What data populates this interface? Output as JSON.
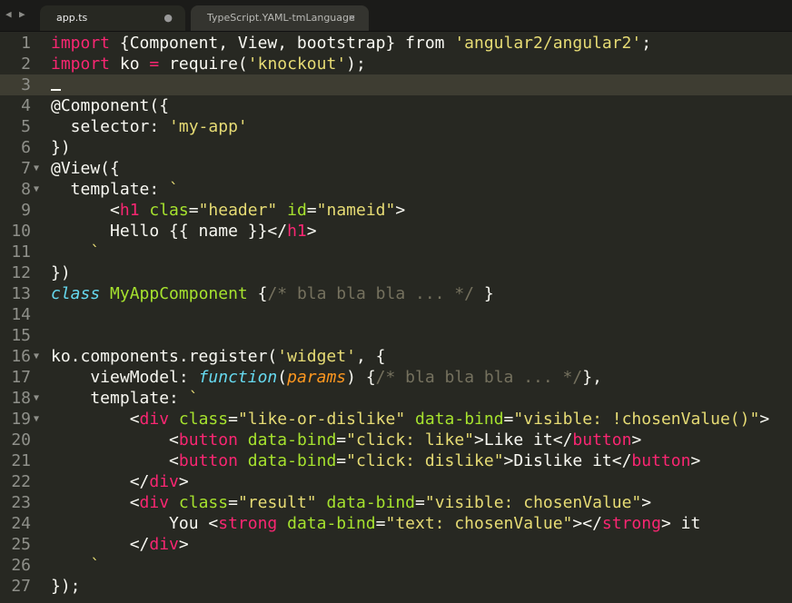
{
  "tabs": [
    {
      "label": "app.ts",
      "status": "modified-dot"
    },
    {
      "label": "TypeScript.YAML-tmLanguage",
      "status": "close"
    }
  ],
  "nav": {
    "back": "◀",
    "forward": "▶"
  },
  "current_line": 3,
  "folds": [
    7,
    8,
    16,
    18,
    19
  ],
  "lines": [
    [
      [
        "kw",
        "import"
      ],
      [
        "tx",
        " {Component, View, bootstrap} from "
      ],
      [
        "str",
        "'angular2/angular2'"
      ],
      [
        "tx",
        ";"
      ]
    ],
    [
      [
        "kw",
        "import"
      ],
      [
        "tx",
        " ko "
      ],
      [
        "kw",
        "="
      ],
      [
        "tx",
        " require("
      ],
      [
        "str",
        "'knockout'"
      ],
      [
        "tx",
        ");"
      ]
    ],
    [],
    [
      [
        "tx",
        "@Component({"
      ]
    ],
    [
      [
        "tx",
        "  selector: "
      ],
      [
        "str",
        "'my-app'"
      ]
    ],
    [
      [
        "tx",
        "})"
      ]
    ],
    [
      [
        "tx",
        "@View({"
      ]
    ],
    [
      [
        "tx",
        "  template: "
      ],
      [
        "str",
        "`"
      ]
    ],
    [
      [
        "tx",
        "      <"
      ],
      [
        "kw",
        "h1"
      ],
      [
        "ent",
        " clas"
      ],
      [
        "tx",
        "="
      ],
      [
        "str",
        "\"header\""
      ],
      [
        "ent",
        " id"
      ],
      [
        "tx",
        "="
      ],
      [
        "str",
        "\"nameid\""
      ],
      [
        "tx",
        ">"
      ]
    ],
    [
      [
        "tx",
        "      Hello {{ name }}</"
      ],
      [
        "kw",
        "h1"
      ],
      [
        "tx",
        ">"
      ]
    ],
    [
      [
        "str",
        "    `"
      ]
    ],
    [
      [
        "tx",
        "})"
      ]
    ],
    [
      [
        "sto",
        "class"
      ],
      [
        "tx",
        " "
      ],
      [
        "ent",
        "MyAppComponent"
      ],
      [
        "tx",
        " {"
      ],
      [
        "com",
        "/* bla bla bla ... */"
      ],
      [
        "tx",
        " }"
      ]
    ],
    [],
    [],
    [
      [
        "tx",
        "ko.components.register("
      ],
      [
        "str",
        "'widget'"
      ],
      [
        "tx",
        ", {"
      ]
    ],
    [
      [
        "tx",
        "    viewModel: "
      ],
      [
        "sto",
        "function"
      ],
      [
        "tx",
        "("
      ],
      [
        "par",
        "params"
      ],
      [
        "tx",
        ") {"
      ],
      [
        "com",
        "/* bla bla bla ... */"
      ],
      [
        "tx",
        "},"
      ]
    ],
    [
      [
        "tx",
        "    template: "
      ],
      [
        "str",
        "`"
      ]
    ],
    [
      [
        "tx",
        "        <"
      ],
      [
        "kw",
        "div"
      ],
      [
        "ent",
        " class"
      ],
      [
        "tx",
        "="
      ],
      [
        "str",
        "\"like-or-dislike\""
      ],
      [
        "ent",
        " data-bind"
      ],
      [
        "tx",
        "="
      ],
      [
        "str",
        "\"visible: !chosenValue()\""
      ],
      [
        "tx",
        ">"
      ]
    ],
    [
      [
        "tx",
        "            <"
      ],
      [
        "kw",
        "button"
      ],
      [
        "ent",
        " data-bind"
      ],
      [
        "tx",
        "="
      ],
      [
        "str",
        "\"click: like\""
      ],
      [
        "tx",
        ">Like it</"
      ],
      [
        "kw",
        "button"
      ],
      [
        "tx",
        ">"
      ]
    ],
    [
      [
        "tx",
        "            <"
      ],
      [
        "kw",
        "button"
      ],
      [
        "ent",
        " data-bind"
      ],
      [
        "tx",
        "="
      ],
      [
        "str",
        "\"click: dislike\""
      ],
      [
        "tx",
        ">Dislike it</"
      ],
      [
        "kw",
        "button"
      ],
      [
        "tx",
        ">"
      ]
    ],
    [
      [
        "tx",
        "        </"
      ],
      [
        "kw",
        "div"
      ],
      [
        "tx",
        ">"
      ]
    ],
    [
      [
        "tx",
        "        <"
      ],
      [
        "kw",
        "div"
      ],
      [
        "ent",
        " class"
      ],
      [
        "tx",
        "="
      ],
      [
        "str",
        "\"result\""
      ],
      [
        "ent",
        " data-bind"
      ],
      [
        "tx",
        "="
      ],
      [
        "str",
        "\"visible: chosenValue\""
      ],
      [
        "tx",
        ">"
      ]
    ],
    [
      [
        "tx",
        "            You <"
      ],
      [
        "kw",
        "strong"
      ],
      [
        "ent",
        " data-bind"
      ],
      [
        "tx",
        "="
      ],
      [
        "str",
        "\"text: chosenValue\""
      ],
      [
        "tx",
        "></"
      ],
      [
        "kw",
        "strong"
      ],
      [
        "tx",
        "> it"
      ]
    ],
    [
      [
        "tx",
        "        </"
      ],
      [
        "kw",
        "div"
      ],
      [
        "tx",
        ">"
      ]
    ],
    [
      [
        "str",
        "    `"
      ]
    ],
    [
      [
        "tx",
        "});"
      ]
    ]
  ]
}
